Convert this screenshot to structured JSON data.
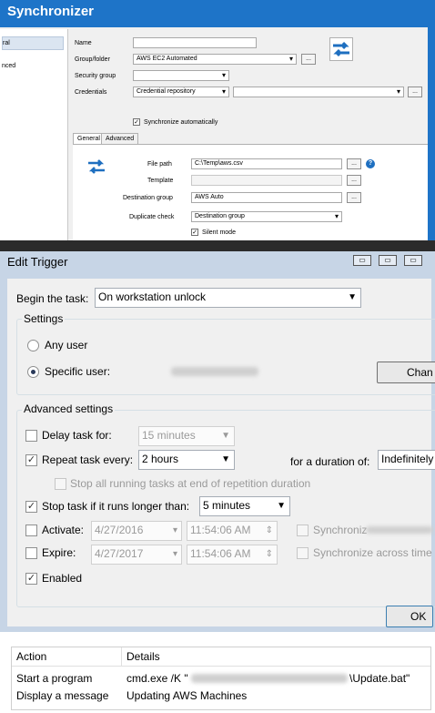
{
  "sync": {
    "title": "Synchronizer",
    "sidebar_items": [
      "ral",
      "nced"
    ],
    "labels": {
      "name": "Name",
      "group": "Group/folder",
      "security": "Security group",
      "credentials": "Credentials",
      "sync_auto": "Synchronize automatically"
    },
    "values": {
      "group": "AWS EC2 Automated",
      "credentials": "Credential repository"
    },
    "tabs": [
      "General",
      "Advanced"
    ],
    "general": {
      "file_path_label": "File path",
      "file_path_value": "C:\\Temp\\aws.csv",
      "template_label": "Template",
      "dest_group_label": "Destination group",
      "dest_group_value": "AWS Auto",
      "dup_check_label": "Duplicate check",
      "dup_check_value": "Destination group",
      "silent_mode": "Silent mode"
    },
    "browse": "..."
  },
  "dialog": {
    "title": "Edit Trigger",
    "begin_label": "Begin the task:",
    "begin_value": "On workstation unlock",
    "settings_label": "Settings",
    "any_user": "Any user",
    "specific_user": "Specific user:",
    "change_btn": "Chan",
    "advanced_label": "Advanced settings",
    "delay_label": "Delay task for:",
    "delay_value": "15 minutes",
    "repeat_label": "Repeat task every:",
    "repeat_value": "2 hours",
    "duration_label": "for a duration of:",
    "duration_value": "Indefinitely",
    "stop_running": "Stop all running tasks at end of repetition duration",
    "stop_longer_label": "Stop task if it runs longer than:",
    "stop_longer_value": "5 minutes",
    "activate_label": "Activate:",
    "activate_date": "4/27/2016",
    "activate_time": "11:54:06 AM",
    "expire_label": "Expire:",
    "expire_date": "4/27/2017",
    "expire_time": "11:54:06 AM",
    "sync_tz_1": "Synchroniz",
    "sync_tz_2": "Synchronize across time",
    "enabled_label": "Enabled",
    "ok_btn": "OK"
  },
  "table": {
    "headers": [
      "Action",
      "Details"
    ],
    "rows": [
      {
        "action": "Start a program",
        "details_prefix": "cmd.exe /K \"",
        "details_suffix": "\\Update.bat\""
      },
      {
        "action": "Display a message",
        "details": "Updating AWS Machines"
      }
    ]
  }
}
